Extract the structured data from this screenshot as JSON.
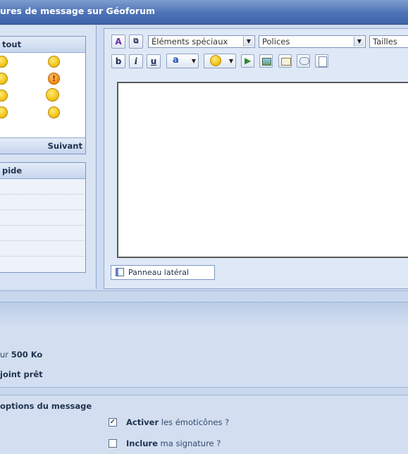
{
  "title_bar": {
    "text": "ures de message sur Géoforum"
  },
  "smilies_box": {
    "header": "tout",
    "next_label": "Suivant"
  },
  "quick_box": {
    "header": "pide"
  },
  "toolbar": {
    "special_select": "Éléments spéciaux",
    "font_select": "Polices",
    "size_select": "Tailles",
    "bold": "b",
    "italic": "i",
    "underline": "u",
    "font_color": "a"
  },
  "side_panel_button": "Panneau latéral",
  "attachments": {
    "size_prefix": "ur ",
    "size_value": "500 Ko",
    "ready_text": "joint prêt"
  },
  "options": {
    "header": "options du message",
    "smilies_bold": "Activer",
    "smilies_rest": " les émoticônes ?",
    "smilies_checked": true,
    "signature_bold": "Inclure",
    "signature_rest": " ma signature ?",
    "signature_checked": false
  }
}
